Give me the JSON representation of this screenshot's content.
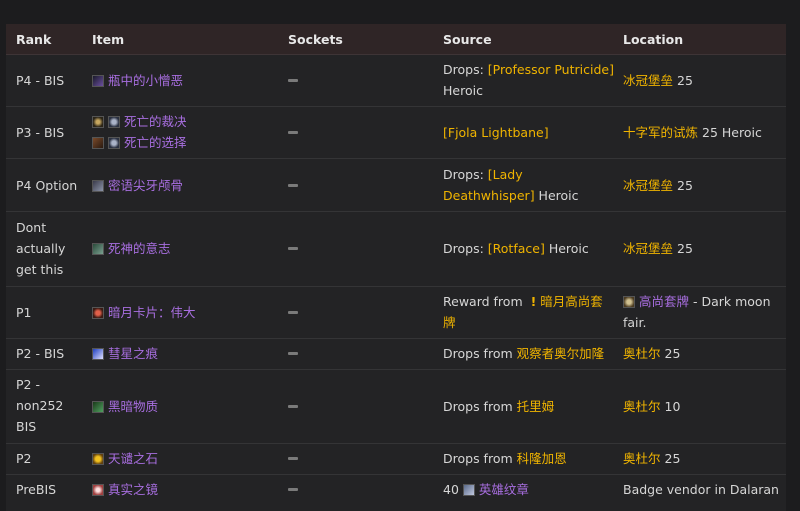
{
  "table": {
    "headers": {
      "rank": "Rank",
      "item": "Item",
      "sockets": "Sockets",
      "source": "Source",
      "location": "Location"
    },
    "socket_mark": "—",
    "rows": [
      {
        "rank": "P4 - BIS",
        "items": [
          {
            "icon": "vial-icon",
            "name": "瓶中的小憎恶"
          }
        ],
        "source": {
          "prefix": "Drops: ",
          "link": "[Professor Putricide]",
          "suffix": " Heroic"
        },
        "location": {
          "link": "冰冠堡垒",
          "suffix": " 25"
        }
      },
      {
        "rank": "P3 - BIS",
        "items": [
          {
            "icon": "ring-icon",
            "icon2": "skull-icon",
            "name": "死亡的裁决"
          },
          {
            "icon": "shield-icon",
            "icon2": "skull-icon",
            "name": "死亡的选择"
          }
        ],
        "source": {
          "prefix": "",
          "link": "[Fjola Lightbane]",
          "suffix": ""
        },
        "location": {
          "link": "十字军的试炼",
          "suffix": " 25 Heroic"
        }
      },
      {
        "rank": "P4 Option",
        "items": [
          {
            "icon": "fang-icon",
            "name": "密语尖牙颅骨"
          }
        ],
        "source": {
          "prefix": "Drops: ",
          "link": "[Lady Deathwhisper]",
          "suffix": " Heroic"
        },
        "location": {
          "link": "冰冠堡垒",
          "suffix": " 25"
        }
      },
      {
        "rank": "Dont actually get this",
        "items": [
          {
            "icon": "sigil-icon",
            "name": "死神的意志"
          }
        ],
        "source": {
          "prefix": "Drops: ",
          "link": "[Rotface]",
          "suffix": " Heroic"
        },
        "location": {
          "link": "冰冠堡垒",
          "suffix": " 25"
        }
      },
      {
        "rank": "P1",
        "items": [
          {
            "icon": "card-icon",
            "name": "暗月卡片：伟大"
          }
        ],
        "source": {
          "prefix": "Reward from ",
          "excl": "!",
          "link": "暗月高尚套牌",
          "suffix": ""
        },
        "location": {
          "icon": "deck-icon",
          "link": "高尚套牌",
          "suffix": " - Dark moon fair."
        }
      },
      {
        "rank": "P2 - BIS",
        "items": [
          {
            "icon": "comet-icon",
            "name": "彗星之痕"
          }
        ],
        "source": {
          "prefix": "Drops from ",
          "link": "观察者奥尔加隆",
          "suffix": ""
        },
        "location": {
          "link": "奥杜尔",
          "suffix": " 25"
        }
      },
      {
        "rank": "P2 - non252 BIS",
        "items": [
          {
            "icon": "dark-matter-icon",
            "name": "黑暗物质"
          }
        ],
        "source": {
          "prefix": "Drops from ",
          "link": "托里姆",
          "suffix": ""
        },
        "location": {
          "link": "奥杜尔",
          "suffix": " 10"
        }
      },
      {
        "rank": "P2",
        "items": [
          {
            "icon": "stone-icon",
            "name": "天谴之石"
          }
        ],
        "source": {
          "prefix": "Drops from ",
          "link": "科隆加恩",
          "suffix": ""
        },
        "location": {
          "link": "奥杜尔",
          "suffix": " 25"
        }
      },
      {
        "rank": "PreBIS",
        "items": [
          {
            "icon": "eye-icon",
            "name": "真实之镜"
          }
        ],
        "source": {
          "prefix": "40 ",
          "icon": "emblem-icon",
          "link": "英雄纹章",
          "suffix": ""
        },
        "location": {
          "plain": "Badge vendor in Dalaran"
        }
      }
    ]
  }
}
